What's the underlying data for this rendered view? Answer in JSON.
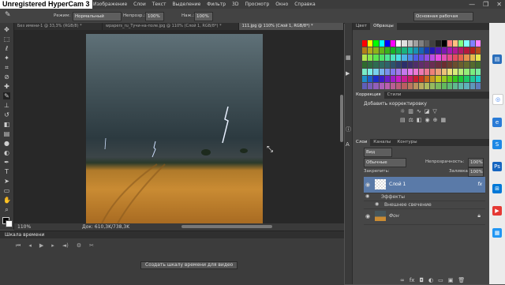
{
  "watermark": "Unregistered HyperCam 3",
  "menu": [
    "Изображение",
    "Слои",
    "Текст",
    "Выделение",
    "Фильтр",
    "3D",
    "Просмотр",
    "Окно",
    "Справка"
  ],
  "window_controls": {
    "minimize": "—",
    "restore": "❐",
    "close": "✕"
  },
  "options": {
    "mode_label": "Режим:",
    "mode_value": "Нормальный",
    "opacity_label": "Непрозр.:",
    "opacity_value": "100%",
    "flow_label": "Наж.:",
    "flow_value": "100%",
    "workspace": "Основная рабочая среда"
  },
  "doc_tabs": [
    {
      "label": "Без имени-1 @ 33,3% (RGB/8) *",
      "active": false
    },
    {
      "label": "wpapers_ru_Тучи-на-поле.jpg @ 110% (Слой 1, RGB/8*) *",
      "active": false
    },
    {
      "label": "111.jpg @ 110% (Слой 1, RGB/8*) *",
      "active": true
    }
  ],
  "status": {
    "zoom": "110%",
    "doc": "Док: 610,3K/738,3K"
  },
  "timeline": {
    "title": "Шкала времени",
    "create_button": "Создать шкалу времени для видео"
  },
  "color_panel": {
    "tabs": [
      "Цвет",
      "Образцы"
    ],
    "active": "Образцы"
  },
  "adjustments": {
    "tabs": [
      "Коррекция",
      "Стили"
    ],
    "add_label": "Добавить корректировку"
  },
  "layers_panel": {
    "tabs": [
      "Слои",
      "Каналы",
      "Контуры"
    ],
    "kind": "Вид",
    "blend": "Обычные",
    "opacity_label": "Непрозрачность:",
    "opacity_value": "100%",
    "lock_label": "Закрепить:",
    "fill_label": "Заливка:",
    "fill_value": "100%",
    "layers": [
      {
        "name": "Слой 1",
        "selected": true
      },
      {
        "name": "Эффекты",
        "selected": false
      },
      {
        "name": "Внешнее свечение",
        "selected": false
      },
      {
        "name": "Фон",
        "selected": false
      }
    ]
  },
  "colors": {
    "accent": "#5a7aa8",
    "panel": "#464646",
    "canvas_bg": "#282828"
  }
}
